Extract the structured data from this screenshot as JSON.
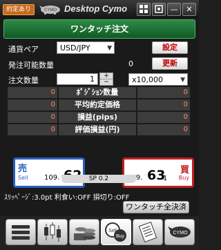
{
  "titlebar": {
    "badge": "約定あり",
    "app_title": "Desktop Cymo"
  },
  "header": {
    "title": "ワンタッチ注文"
  },
  "form": {
    "pair_label": "通貨ペア",
    "pair_value": "USD/JPY",
    "settings_button": "設定",
    "orderable_label": "発注可能数量",
    "orderable_value": "0",
    "refresh_button": "更新",
    "qty_label": "注文数量",
    "qty_value": "1",
    "unit_value": "x10,000"
  },
  "stats": [
    {
      "label": "ﾎﾟｼﾞｼｮﾝ数量",
      "left": "0",
      "right": "0"
    },
    {
      "label": "平均約定価格",
      "left": "0",
      "right": "0"
    },
    {
      "label": "損益(pips)",
      "left": "0",
      "right": "0"
    },
    {
      "label": "評価損益(円)",
      "left": "0",
      "right": "0"
    }
  ],
  "sell": {
    "side": "売",
    "sub": "Sell",
    "prefix": "109.",
    "big": "62",
    "pip": "9"
  },
  "buy": {
    "side": "買",
    "sub": "Buy",
    "prefix": "109.",
    "big": "63",
    "pip": "1"
  },
  "spread": "SP 0.2",
  "status_line": "ｽﾘｯﾍﾟｰｼﾞ:3.0pt 利食い:OFF 損切り:OFF",
  "close_all_button": "ワンタッチ全決済",
  "colors": {
    "header_green": "#1f7a3a",
    "sell_blue": "#2a5fc0",
    "buy_red": "#c02020",
    "badge_orange": "#c86a1a"
  },
  "toolbar_icons": [
    "list-icon",
    "candlestick-chart-icon",
    "coins-icon",
    "sell-buy-icon",
    "receipt-icon",
    "cymo-logo-icon"
  ]
}
